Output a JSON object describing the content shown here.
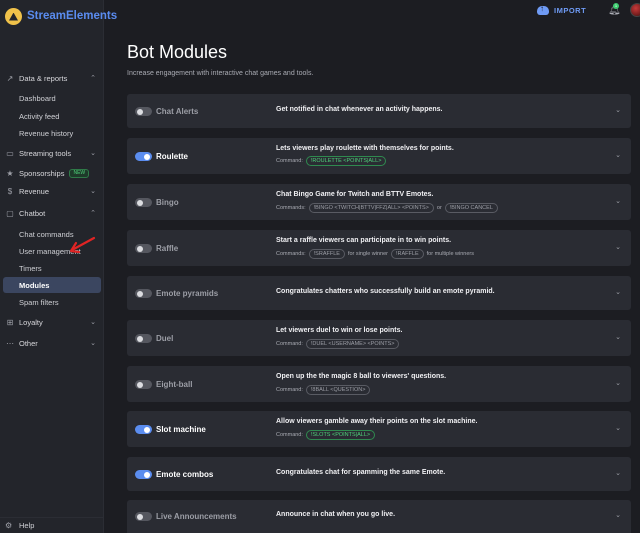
{
  "app": {
    "brand": "StreamElements"
  },
  "topbar": {
    "import_label": "IMPORT",
    "notification_count": "1"
  },
  "sidebar": {
    "groups": [
      {
        "label": "Data & reports",
        "icon": "chart-line-icon"
      },
      {
        "label": "Streaming tools",
        "icon": ""
      },
      {
        "label": "Sponsorships",
        "icon": "star-icon",
        "badge": "NEW"
      },
      {
        "label": "Revenue",
        "icon": "dollar-icon"
      },
      {
        "label": "Chatbot",
        "icon": ""
      },
      {
        "label": "Loyalty",
        "icon": "gift-icon"
      },
      {
        "label": "Other",
        "icon": "dots-icon"
      }
    ],
    "items": [
      {
        "label": "Dashboard"
      },
      {
        "label": "Activity feed"
      },
      {
        "label": "Revenue history"
      },
      {
        "label": "Chat commands"
      },
      {
        "label": "User management"
      },
      {
        "label": "Timers"
      },
      {
        "label": "Modules"
      },
      {
        "label": "Spam filters"
      }
    ],
    "help_label": "Help"
  },
  "main": {
    "title": "Bot Modules",
    "subtitle": "Increase engagement with interactive chat games and tools.",
    "modules": [
      {
        "name": "Chat Alerts",
        "enabled": false,
        "description": "Get notified in chat whenever an activity happens."
      },
      {
        "name": "Roulette",
        "enabled": true,
        "description": "Lets viewers play roulette with themselves for points.",
        "command_label": "Command:",
        "chips": [
          "!ROULETTE <POINTS|ALL>"
        ]
      },
      {
        "name": "Bingo",
        "enabled": false,
        "description": "Chat Bingo Game for Twitch and BTTV Emotes.",
        "command_label": "Commands:",
        "chips": [
          "!BINGO <TWITCH|BTTV|FFZ|ALL> <POINTS>",
          "!BINGO CANCEL"
        ],
        "joiner": "or"
      },
      {
        "name": "Raffle",
        "enabled": false,
        "description": "Start a raffle viewers can participate in to win points.",
        "command_label": "Commands:",
        "chips": [
          "!SRAFFLE",
          "!RAFFLE"
        ],
        "chip_suffixes": [
          "for single winner",
          "for multiple winners"
        ]
      },
      {
        "name": "Emote pyramids",
        "enabled": false,
        "description": "Congratulates chatters who successfully build an emote pyramid."
      },
      {
        "name": "Duel",
        "enabled": false,
        "description": "Let viewers duel to win or lose points.",
        "command_label": "Command:",
        "chips": [
          "!DUEL <USERNAME> <POINTS>"
        ]
      },
      {
        "name": "Eight-ball",
        "enabled": false,
        "description": "Open up the the magic 8 ball to viewers' questions.",
        "command_label": "Command:",
        "chips": [
          "!8BALL <QUESTION>"
        ]
      },
      {
        "name": "Slot machine",
        "enabled": true,
        "description": "Allow viewers gamble away their points on the slot machine.",
        "command_label": "Command:",
        "chips": [
          "!SLOTS <POINTS|ALL>"
        ]
      },
      {
        "name": "Emote combos",
        "enabled": true,
        "description": "Congratulates chat for spamming the same Emote."
      },
      {
        "name": "Live Announcements",
        "enabled": false,
        "description": "Announce in chat when you go live."
      }
    ]
  },
  "colors": {
    "accent": "#5b8def",
    "command_green": "#4fd07a",
    "background": "#1c1d22",
    "card": "#2a2c33",
    "sidebar": "#23252b",
    "annotation_arrow": "#e02424"
  }
}
